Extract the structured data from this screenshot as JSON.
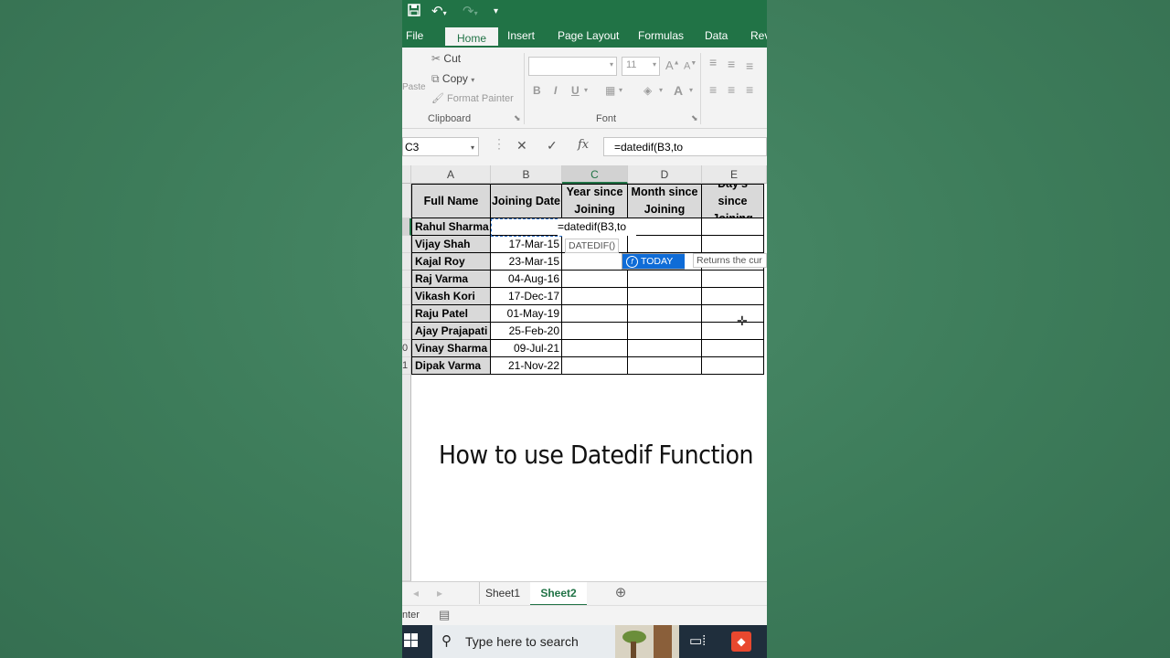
{
  "ribbon": {
    "tabs": [
      "File",
      "Home",
      "Insert",
      "Page Layout",
      "Formulas",
      "Data",
      "Rev"
    ],
    "active_tab": "Home",
    "clipboard": {
      "cut": "Cut",
      "copy": "Copy",
      "format_painter": "Format Painter",
      "paste": "Paste",
      "group": "Clipboard"
    },
    "font": {
      "size": "11",
      "group": "Font",
      "bold": "B",
      "italic": "I",
      "underline": "U",
      "grow": "A",
      "shrink": "A",
      "color": "A"
    }
  },
  "formula_bar": {
    "name_box": "C3",
    "content": "=datedif(B3,to"
  },
  "sheet": {
    "columns": [
      "A",
      "B",
      "C",
      "D",
      "E"
    ],
    "headers": [
      "Full Name",
      "Joining Date",
      "Year since Joining",
      "Month since Joining",
      "Day's since Joining"
    ],
    "rows": [
      {
        "name": "Rahul Sharma",
        "date": ""
      },
      {
        "name": "Vijay Shah",
        "date": "17-Mar-15"
      },
      {
        "name": "Kajal Roy",
        "date": "23-Mar-15"
      },
      {
        "name": "Raj Varma",
        "date": "04-Aug-16"
      },
      {
        "name": "Vikash Kori",
        "date": "17-Dec-17"
      },
      {
        "name": "Raju Patel",
        "date": "01-May-19"
      },
      {
        "name": "Ajay Prajapati",
        "date": "25-Feb-20"
      },
      {
        "name": "Vinay Sharma",
        "date": "09-Jul-21"
      },
      {
        "name": "Dipak Varma",
        "date": "21-Nov-22"
      }
    ],
    "row_numbers": [
      "0",
      "1",
      "",
      "",
      "",
      "",
      "",
      "",
      "",
      "",
      "",
      "",
      "",
      "",
      "",
      "",
      "",
      ""
    ],
    "editing_text": "=datedif(B3,to",
    "tooltip": "DATEDIF()",
    "autocomplete_item": "TODAY",
    "autocomplete_desc": "Returns the cur"
  },
  "caption": "How to use Datedif Function",
  "sheet_tabs": [
    "Sheet1",
    "Sheet2"
  ],
  "active_sheet": "Sheet2",
  "status": {
    "mode": "nter"
  },
  "taskbar": {
    "search_placeholder": "Type here to search"
  },
  "colors": {
    "excel_green": "#217346",
    "accent_blue": "#0f6cd7"
  }
}
